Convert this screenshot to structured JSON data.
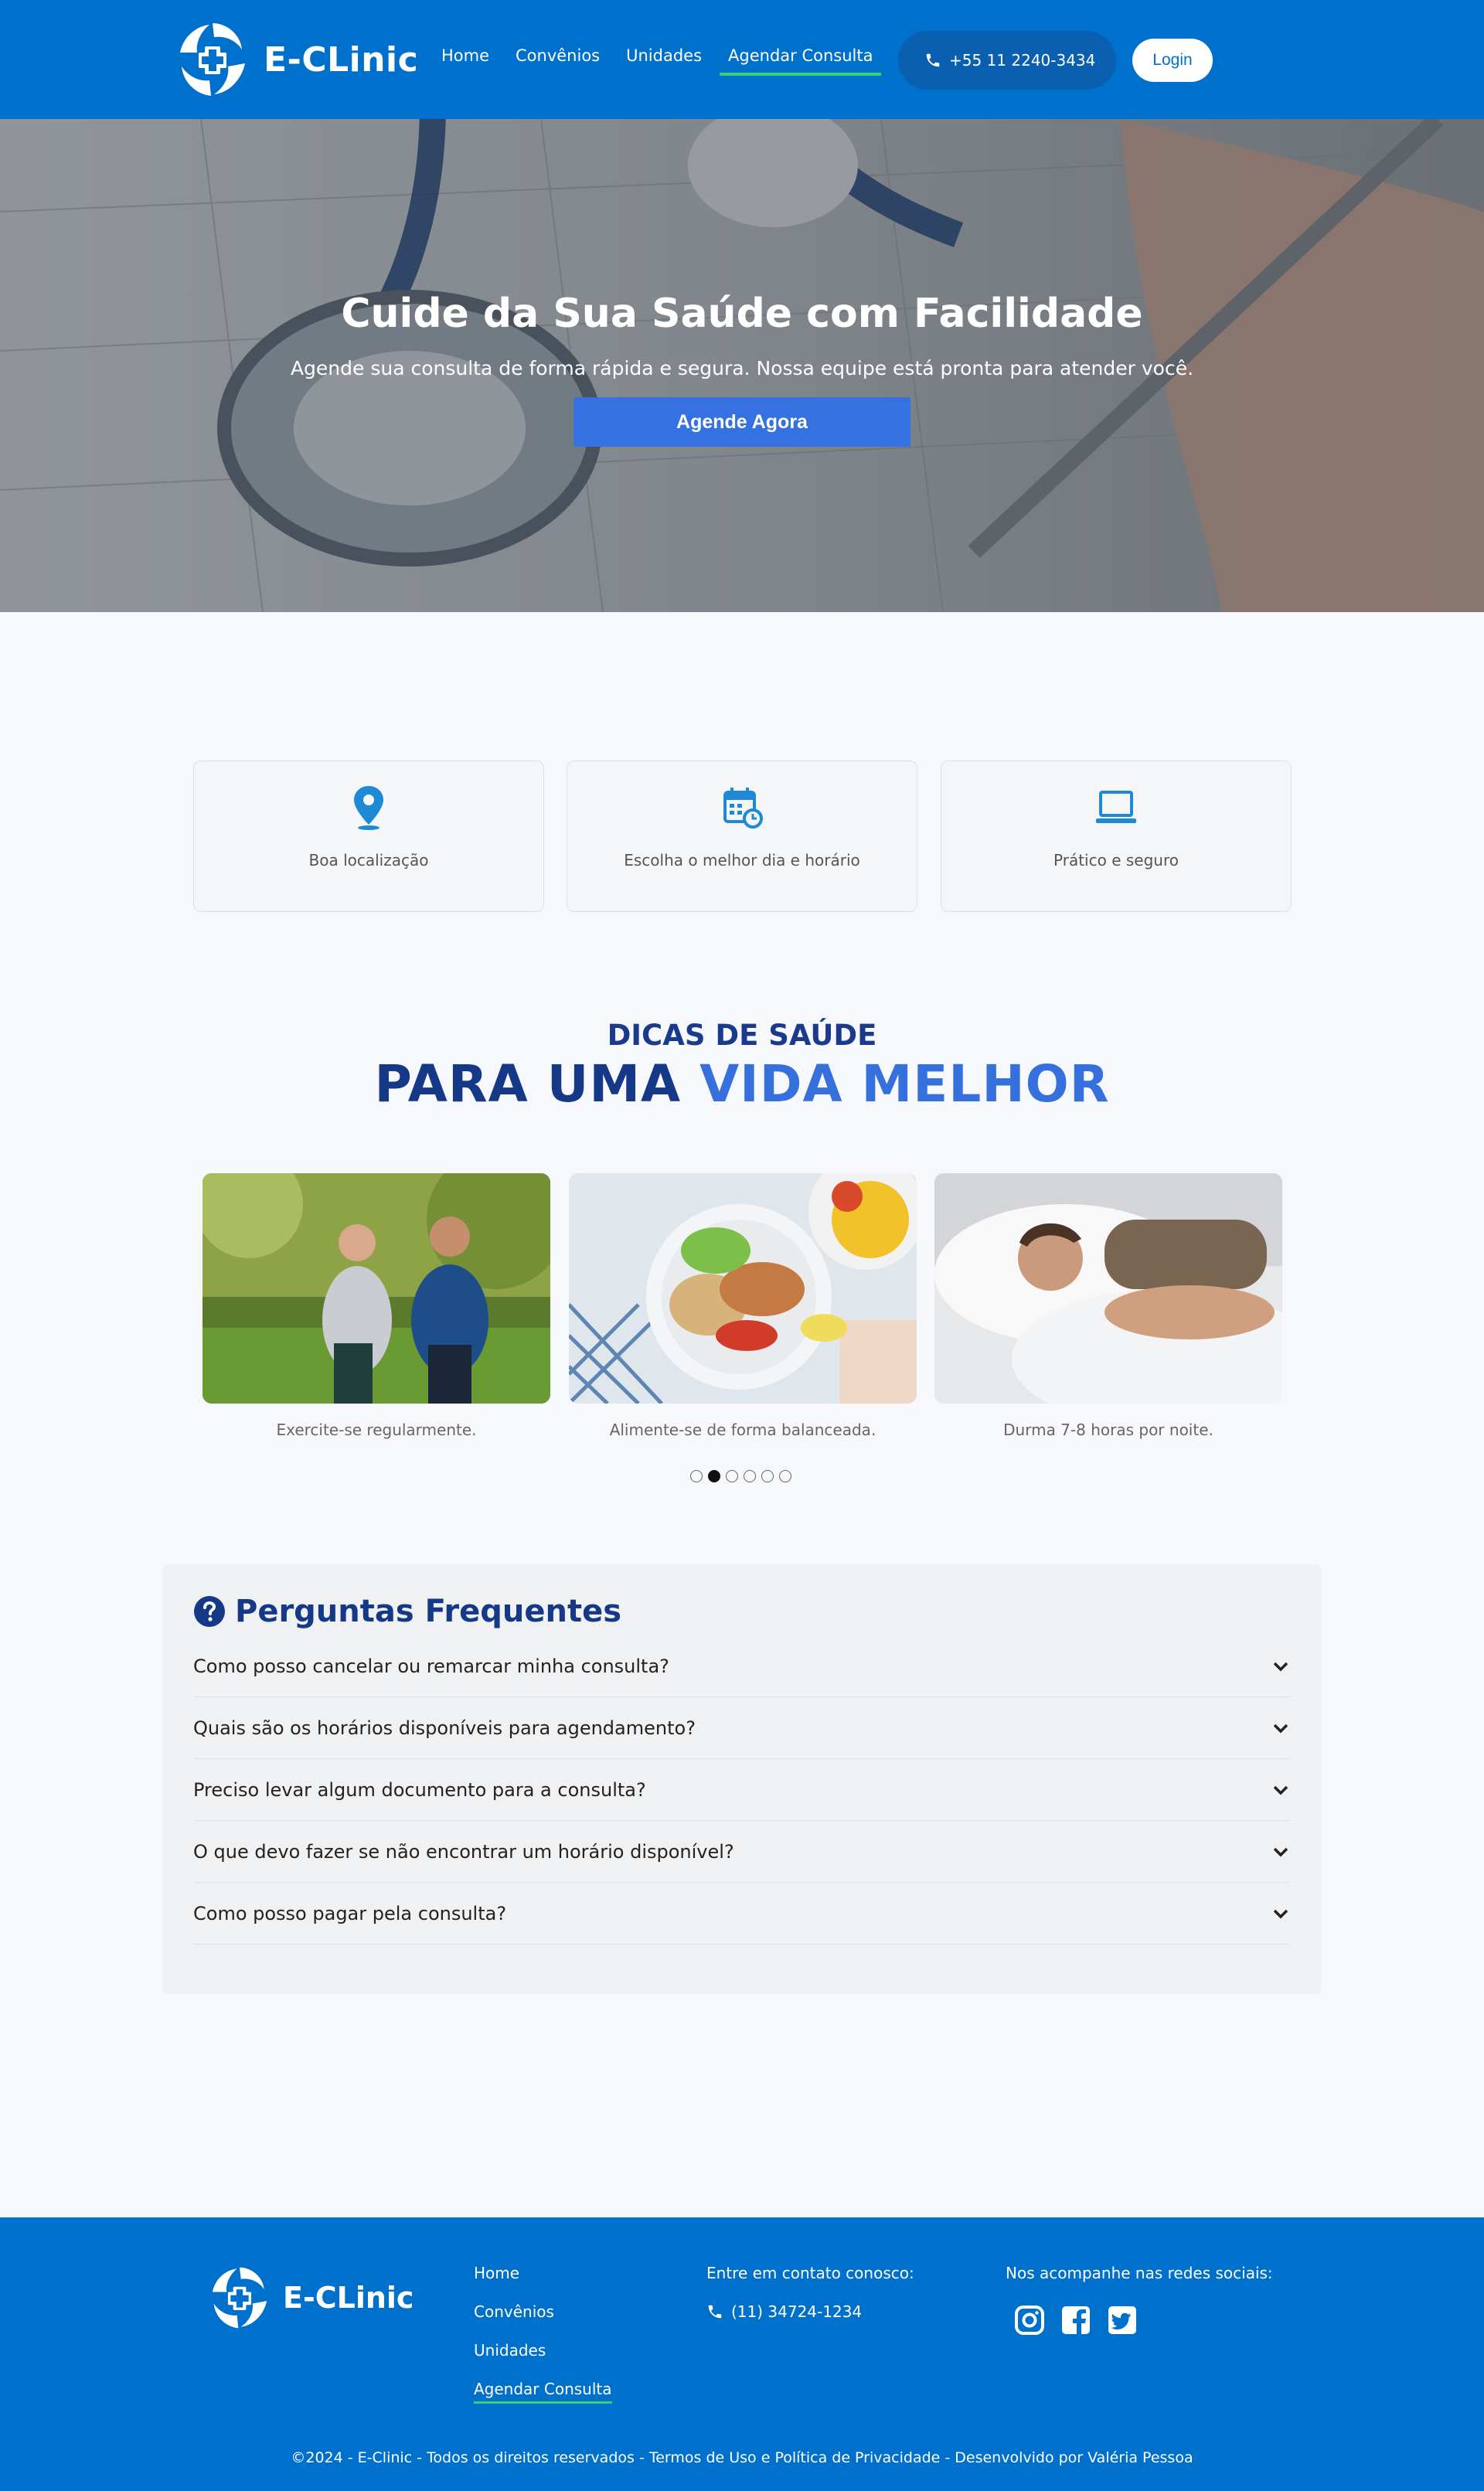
{
  "brand": {
    "name": "E-CLinic",
    "footer_name": "E-CLinic"
  },
  "nav": [
    {
      "label": "Home"
    },
    {
      "label": "Convênios"
    },
    {
      "label": "Unidades"
    },
    {
      "label": "Agendar Consulta",
      "active": true
    }
  ],
  "header": {
    "phone": "+55 11 2240-3434",
    "login_label": "Login"
  },
  "hero": {
    "title": "Cuide da Sua Saúde com Facilidade",
    "subtitle": "Agende sua consulta de forma rápida e segura. Nossa equipe está pronta para atender você.",
    "cta_label": "Agende Agora"
  },
  "features": [
    {
      "icon": "map-pin-icon",
      "label": "Boa localização"
    },
    {
      "icon": "calendar-clock-icon",
      "label": "Escolha o melhor dia e horário"
    },
    {
      "icon": "laptop-icon",
      "label": "Prático e seguro"
    }
  ],
  "tips": {
    "kicker": "DICAS DE SAÚDE",
    "title_part1": "PARA UMA ",
    "title_part2": "VIDA MELHOR",
    "cards": [
      {
        "caption": "Exercite-se regularmente."
      },
      {
        "caption": "Alimente-se de forma balanceada."
      },
      {
        "caption": "Durma 7-8 horas por noite."
      }
    ],
    "active_dot_index": 1,
    "dot_count": 6
  },
  "faq": {
    "title": "Perguntas Frequentes",
    "items": [
      {
        "question": "Como posso cancelar ou remarcar minha consulta?"
      },
      {
        "question": "Quais são os horários disponíveis para agendamento?"
      },
      {
        "question": "Preciso levar algum documento para a consulta?"
      },
      {
        "question": "O que devo fazer se não encontrar um horário disponível?"
      },
      {
        "question": "Como posso pagar pela consulta?"
      }
    ]
  },
  "footer": {
    "links": [
      {
        "label": "Home"
      },
      {
        "label": "Convênios"
      },
      {
        "label": "Unidades"
      },
      {
        "label": "Agendar Consulta",
        "active": true
      }
    ],
    "contact_title": "Entre em contato conosco:",
    "contact_phone": "(11) 34724-1234",
    "social_title": "Nos acompanhe nas redes sociais:",
    "social": [
      "instagram-icon",
      "facebook-icon",
      "twitter-icon"
    ],
    "copyright": "©2024 - E-Clinic - Todos os direitos reservados - Termos de Uso e Política de Privacidade - Desenvolvido por Valéria Pessoa"
  },
  "colors": {
    "primary": "#0070cd",
    "accent_blue": "#3670dc",
    "navy": "#153887",
    "nav_underline": "#32d27a"
  }
}
